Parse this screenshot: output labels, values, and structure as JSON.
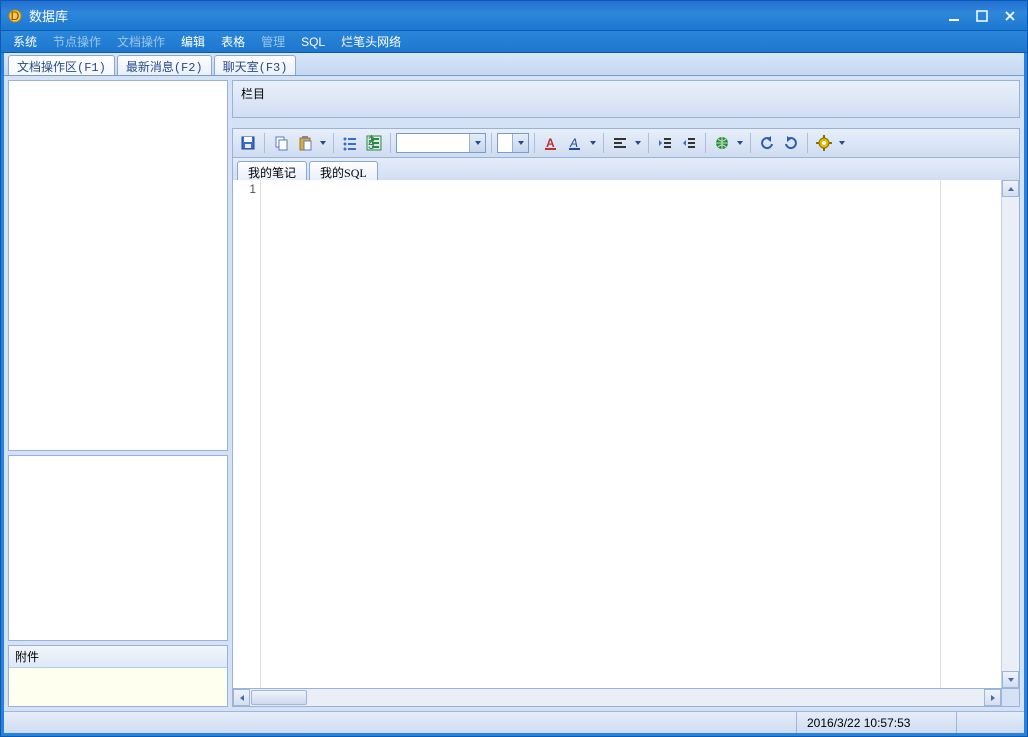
{
  "title": "数据库",
  "menu": {
    "items": [
      {
        "label": "系统",
        "enabled": true
      },
      {
        "label": "节点操作",
        "enabled": false
      },
      {
        "label": "文档操作",
        "enabled": false
      },
      {
        "label": "编辑",
        "enabled": true
      },
      {
        "label": "表格",
        "enabled": true
      },
      {
        "label": "管理",
        "enabled": false
      },
      {
        "label": "SQL",
        "enabled": true
      },
      {
        "label": "烂笔头网络",
        "enabled": true
      }
    ]
  },
  "top_tabs": [
    {
      "label": "文档操作区(F1)",
      "active": true
    },
    {
      "label": "最新消息(F2)",
      "active": false
    },
    {
      "label": "聊天室(F3)",
      "active": false
    }
  ],
  "column_header": "栏目",
  "attachments": {
    "header": "附件"
  },
  "doc_tabs": [
    {
      "label": "我的笔记",
      "active": true
    },
    {
      "label": "我的SQL",
      "active": false
    }
  ],
  "editor": {
    "line_number": "1"
  },
  "toolbar": {
    "icons": [
      "save-icon",
      "copy-icon",
      "paste-icon",
      "sep",
      "bullets-icon",
      "numbering-icon",
      "sep",
      "style-combo",
      "sep",
      "size-combo",
      "sep",
      "font-color-icon",
      "highlight-icon",
      "sep",
      "align-icon",
      "sep",
      "outdent-icon",
      "indent-icon",
      "sep",
      "link-icon",
      "sep",
      "undo-icon",
      "redo-icon",
      "sep",
      "gear-icon"
    ]
  },
  "statusbar": {
    "datetime": "2016/3/22 10:57:53"
  },
  "colors": {
    "accent": "#1f7fd6",
    "panel_border": "#97b3d9"
  }
}
